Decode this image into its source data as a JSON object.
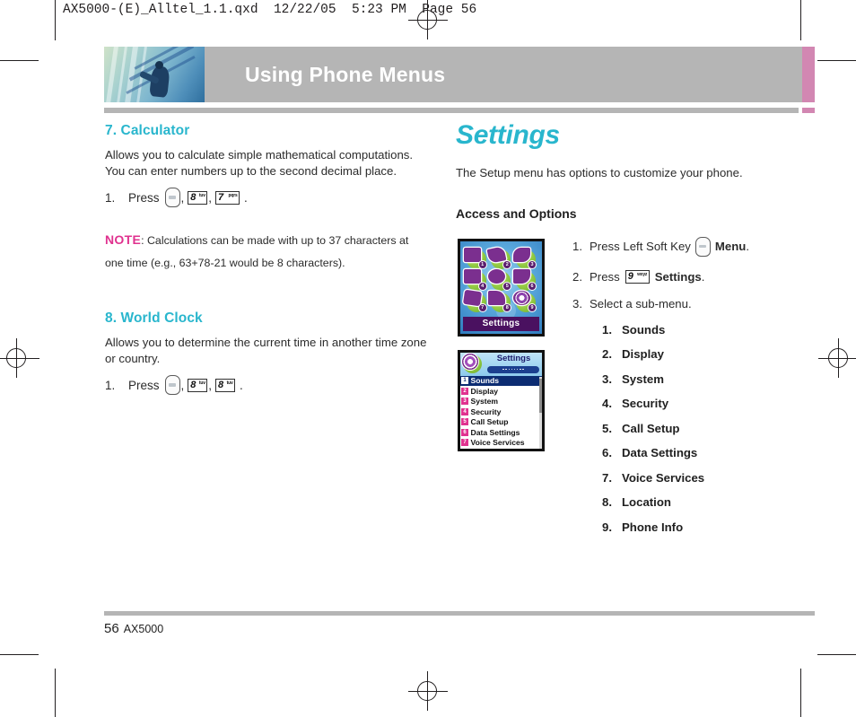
{
  "slug": "AX5000-(E)_Alltel_1.1.qxd  12/22/05  5:23 PM  Page 56",
  "banner": {
    "title": "Using Phone Menus",
    "grey_color": "#b5b5b5",
    "pink_color": "#d287b2",
    "title_color": "#ffffff"
  },
  "colors": {
    "heading_teal": "#29b6cd",
    "note_pink": "#e0328f",
    "body": "#2b2b2b"
  },
  "left_column": {
    "section_7": {
      "heading": "7. Calculator",
      "body": "Allows you to calculate simple mathematical computations. You can enter numbers up to the second decimal place.",
      "step": {
        "num": "1.",
        "verb": "Press",
        "keys": [
          {
            "icon": "soft-key-icon",
            "digit": "",
            "letters": ""
          },
          {
            "icon": "number-key-icon",
            "digit": "8",
            "letters": "tuv"
          },
          {
            "icon": "number-key-icon",
            "digit": "7",
            "letters": "pqrs"
          }
        ],
        "comma": ",",
        "period": "."
      }
    },
    "note": {
      "keyword": "NOTE",
      "text": ": Calculations can be made with up to 37 characters at one time (e.g., 63+78-21 would be 8 characters)."
    },
    "section_8": {
      "heading": "8. World Clock",
      "body": "Allows you to determine the current time in another time zone or country.",
      "step": {
        "num": "1.",
        "verb": "Press",
        "keys": [
          {
            "icon": "soft-key-icon",
            "digit": "",
            "letters": ""
          },
          {
            "icon": "number-key-icon",
            "digit": "8",
            "letters": "tuv"
          },
          {
            "icon": "number-key-icon",
            "digit": "8",
            "letters": "tuv"
          }
        ],
        "comma": ",",
        "period": "."
      }
    }
  },
  "right_column": {
    "title": "Settings",
    "intro": "The Setup menu has options to customize your phone.",
    "subheading": "Access and Options",
    "steps": [
      {
        "num": "1.",
        "pre": "Press Left Soft Key",
        "key": {
          "icon": "soft-key-icon"
        },
        "bold": "Menu",
        "post": "."
      },
      {
        "num": "2.",
        "pre": "Press",
        "key": {
          "icon": "number-key-icon",
          "digit": "9",
          "letters": "wxyz"
        },
        "bold": "Settings",
        "post": "."
      },
      {
        "num": "3.",
        "pre": "Select a sub-menu.",
        "key": null,
        "bold": "",
        "post": ""
      }
    ],
    "submenu": [
      {
        "num": "1.",
        "label": "Sounds"
      },
      {
        "num": "2.",
        "label": "Display"
      },
      {
        "num": "3.",
        "label": "System"
      },
      {
        "num": "4.",
        "label": "Security"
      },
      {
        "num": "5.",
        "label": "Call Setup"
      },
      {
        "num": "6.",
        "label": "Data Settings"
      },
      {
        "num": "7.",
        "label": "Voice Services"
      },
      {
        "num": "8.",
        "label": "Location"
      },
      {
        "num": "9.",
        "label": "Phone Info"
      }
    ],
    "screenshot_grid": {
      "caption": "Settings",
      "icons": [
        {
          "name": "messaging-icon",
          "badge": "1"
        },
        {
          "name": "games-icon",
          "badge": "2"
        },
        {
          "name": "tools-icon",
          "badge": "3"
        },
        {
          "name": "contacts-icon",
          "badge": "4"
        },
        {
          "name": "web-icon",
          "badge": "5"
        },
        {
          "name": "downloads-icon",
          "badge": "6"
        },
        {
          "name": "media-icon",
          "badge": "7"
        },
        {
          "name": "recent-calls-icon",
          "badge": "8"
        },
        {
          "name": "settings-gear-icon",
          "badge": "9"
        }
      ]
    },
    "screenshot_list": {
      "title": "Settings",
      "items": [
        {
          "num": "1",
          "label": "Sounds",
          "selected": true
        },
        {
          "num": "2",
          "label": "Display",
          "selected": false
        },
        {
          "num": "3",
          "label": "System",
          "selected": false
        },
        {
          "num": "4",
          "label": "Security",
          "selected": false
        },
        {
          "num": "5",
          "label": "Call Setup",
          "selected": false
        },
        {
          "num": "6",
          "label": "Data Settings",
          "selected": false
        },
        {
          "num": "7",
          "label": "Voice Services",
          "selected": false
        }
      ]
    }
  },
  "footer": {
    "page_number": "56",
    "book": "AX5000"
  }
}
